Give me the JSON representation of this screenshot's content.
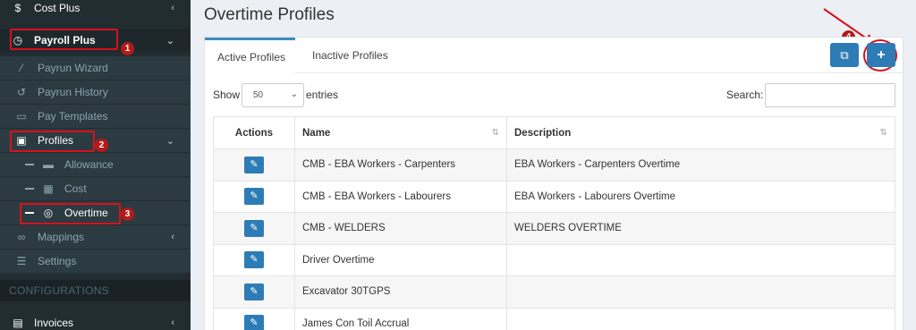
{
  "sidebar": {
    "items": [
      {
        "label": "Cost Plus",
        "icon": "money-bag-icon"
      },
      {
        "label": "Payroll Plus",
        "icon": "clock-icon"
      },
      {
        "label": "Payrun Wizard",
        "icon": "wand-icon"
      },
      {
        "label": "Payrun History",
        "icon": "history-icon"
      },
      {
        "label": "Pay Templates",
        "icon": "money-icon"
      },
      {
        "label": "Profiles",
        "icon": "profile-card-icon"
      },
      {
        "label": "Allowance",
        "icon": "money-icon"
      },
      {
        "label": "Cost",
        "icon": "calendar-icon"
      },
      {
        "label": "Overtime",
        "icon": "stopwatch-icon"
      },
      {
        "label": "Mappings",
        "icon": "link-icon"
      },
      {
        "label": "Settings",
        "icon": "sliders-icon"
      }
    ],
    "section_header": "CONFIGURATIONS",
    "bottom_item": {
      "label": "Invoices",
      "icon": "invoice-icon"
    }
  },
  "annotations": {
    "step1": "1",
    "step2": "2",
    "step3": "3",
    "step4": "4",
    "highlight_color": "#d9101a"
  },
  "page": {
    "title": "Overtime Profiles"
  },
  "tabs": [
    {
      "label": "Active Profiles",
      "active": true
    },
    {
      "label": "Inactive Profiles",
      "active": false
    }
  ],
  "toolbar": {
    "copy_icon": "copy-icon",
    "add_icon": "plus-icon"
  },
  "table_controls": {
    "show_label": "Show",
    "page_size": "50",
    "entries_label": "entries",
    "search_label": "Search:",
    "search_value": ""
  },
  "table": {
    "headers": [
      "Actions",
      "Name",
      "Description"
    ],
    "rows": [
      {
        "name": "CMB - EBA Workers - Carpenters",
        "description": "EBA Workers - Carpenters Overtime"
      },
      {
        "name": "CMB - EBA Workers - Labourers",
        "description": "EBA Workers - Labourers Overtime"
      },
      {
        "name": "CMB - WELDERS",
        "description": "WELDERS OVERTIME"
      },
      {
        "name": "Driver Overtime",
        "description": ""
      },
      {
        "name": "Excavator 30TGPS",
        "description": ""
      },
      {
        "name": "James Con Toil Accrual",
        "description": ""
      }
    ]
  },
  "colors": {
    "sidebar_bg": "#222d32",
    "primary": "#2e7cb6",
    "tab_accent": "#3c8dbc"
  }
}
